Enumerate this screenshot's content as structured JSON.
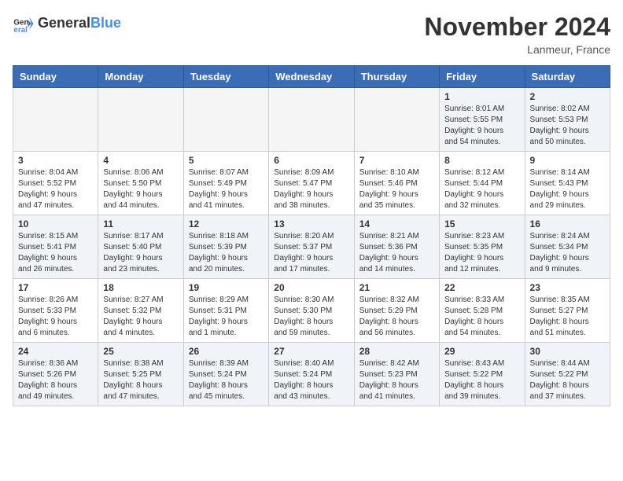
{
  "header": {
    "logo_general": "General",
    "logo_blue": "Blue",
    "month_title": "November 2024",
    "location": "Lanmeur, France"
  },
  "weekdays": [
    "Sunday",
    "Monday",
    "Tuesday",
    "Wednesday",
    "Thursday",
    "Friday",
    "Saturday"
  ],
  "weeks": [
    [
      {
        "day": "",
        "info": ""
      },
      {
        "day": "",
        "info": ""
      },
      {
        "day": "",
        "info": ""
      },
      {
        "day": "",
        "info": ""
      },
      {
        "day": "",
        "info": ""
      },
      {
        "day": "1",
        "info": "Sunrise: 8:01 AM\nSunset: 5:55 PM\nDaylight: 9 hours\nand 54 minutes."
      },
      {
        "day": "2",
        "info": "Sunrise: 8:02 AM\nSunset: 5:53 PM\nDaylight: 9 hours\nand 50 minutes."
      }
    ],
    [
      {
        "day": "3",
        "info": "Sunrise: 8:04 AM\nSunset: 5:52 PM\nDaylight: 9 hours\nand 47 minutes."
      },
      {
        "day": "4",
        "info": "Sunrise: 8:06 AM\nSunset: 5:50 PM\nDaylight: 9 hours\nand 44 minutes."
      },
      {
        "day": "5",
        "info": "Sunrise: 8:07 AM\nSunset: 5:49 PM\nDaylight: 9 hours\nand 41 minutes."
      },
      {
        "day": "6",
        "info": "Sunrise: 8:09 AM\nSunset: 5:47 PM\nDaylight: 9 hours\nand 38 minutes."
      },
      {
        "day": "7",
        "info": "Sunrise: 8:10 AM\nSunset: 5:46 PM\nDaylight: 9 hours\nand 35 minutes."
      },
      {
        "day": "8",
        "info": "Sunrise: 8:12 AM\nSunset: 5:44 PM\nDaylight: 9 hours\nand 32 minutes."
      },
      {
        "day": "9",
        "info": "Sunrise: 8:14 AM\nSunset: 5:43 PM\nDaylight: 9 hours\nand 29 minutes."
      }
    ],
    [
      {
        "day": "10",
        "info": "Sunrise: 8:15 AM\nSunset: 5:41 PM\nDaylight: 9 hours\nand 26 minutes."
      },
      {
        "day": "11",
        "info": "Sunrise: 8:17 AM\nSunset: 5:40 PM\nDaylight: 9 hours\nand 23 minutes."
      },
      {
        "day": "12",
        "info": "Sunrise: 8:18 AM\nSunset: 5:39 PM\nDaylight: 9 hours\nand 20 minutes."
      },
      {
        "day": "13",
        "info": "Sunrise: 8:20 AM\nSunset: 5:37 PM\nDaylight: 9 hours\nand 17 minutes."
      },
      {
        "day": "14",
        "info": "Sunrise: 8:21 AM\nSunset: 5:36 PM\nDaylight: 9 hours\nand 14 minutes."
      },
      {
        "day": "15",
        "info": "Sunrise: 8:23 AM\nSunset: 5:35 PM\nDaylight: 9 hours\nand 12 minutes."
      },
      {
        "day": "16",
        "info": "Sunrise: 8:24 AM\nSunset: 5:34 PM\nDaylight: 9 hours\nand 9 minutes."
      }
    ],
    [
      {
        "day": "17",
        "info": "Sunrise: 8:26 AM\nSunset: 5:33 PM\nDaylight: 9 hours\nand 6 minutes."
      },
      {
        "day": "18",
        "info": "Sunrise: 8:27 AM\nSunset: 5:32 PM\nDaylight: 9 hours\nand 4 minutes."
      },
      {
        "day": "19",
        "info": "Sunrise: 8:29 AM\nSunset: 5:31 PM\nDaylight: 9 hours\nand 1 minute."
      },
      {
        "day": "20",
        "info": "Sunrise: 8:30 AM\nSunset: 5:30 PM\nDaylight: 8 hours\nand 59 minutes."
      },
      {
        "day": "21",
        "info": "Sunrise: 8:32 AM\nSunset: 5:29 PM\nDaylight: 8 hours\nand 56 minutes."
      },
      {
        "day": "22",
        "info": "Sunrise: 8:33 AM\nSunset: 5:28 PM\nDaylight: 8 hours\nand 54 minutes."
      },
      {
        "day": "23",
        "info": "Sunrise: 8:35 AM\nSunset: 5:27 PM\nDaylight: 8 hours\nand 51 minutes."
      }
    ],
    [
      {
        "day": "24",
        "info": "Sunrise: 8:36 AM\nSunset: 5:26 PM\nDaylight: 8 hours\nand 49 minutes."
      },
      {
        "day": "25",
        "info": "Sunrise: 8:38 AM\nSunset: 5:25 PM\nDaylight: 8 hours\nand 47 minutes."
      },
      {
        "day": "26",
        "info": "Sunrise: 8:39 AM\nSunset: 5:24 PM\nDaylight: 8 hours\nand 45 minutes."
      },
      {
        "day": "27",
        "info": "Sunrise: 8:40 AM\nSunset: 5:24 PM\nDaylight: 8 hours\nand 43 minutes."
      },
      {
        "day": "28",
        "info": "Sunrise: 8:42 AM\nSunset: 5:23 PM\nDaylight: 8 hours\nand 41 minutes."
      },
      {
        "day": "29",
        "info": "Sunrise: 8:43 AM\nSunset: 5:22 PM\nDaylight: 8 hours\nand 39 minutes."
      },
      {
        "day": "30",
        "info": "Sunrise: 8:44 AM\nSunset: 5:22 PM\nDaylight: 8 hours\nand 37 minutes."
      }
    ]
  ]
}
